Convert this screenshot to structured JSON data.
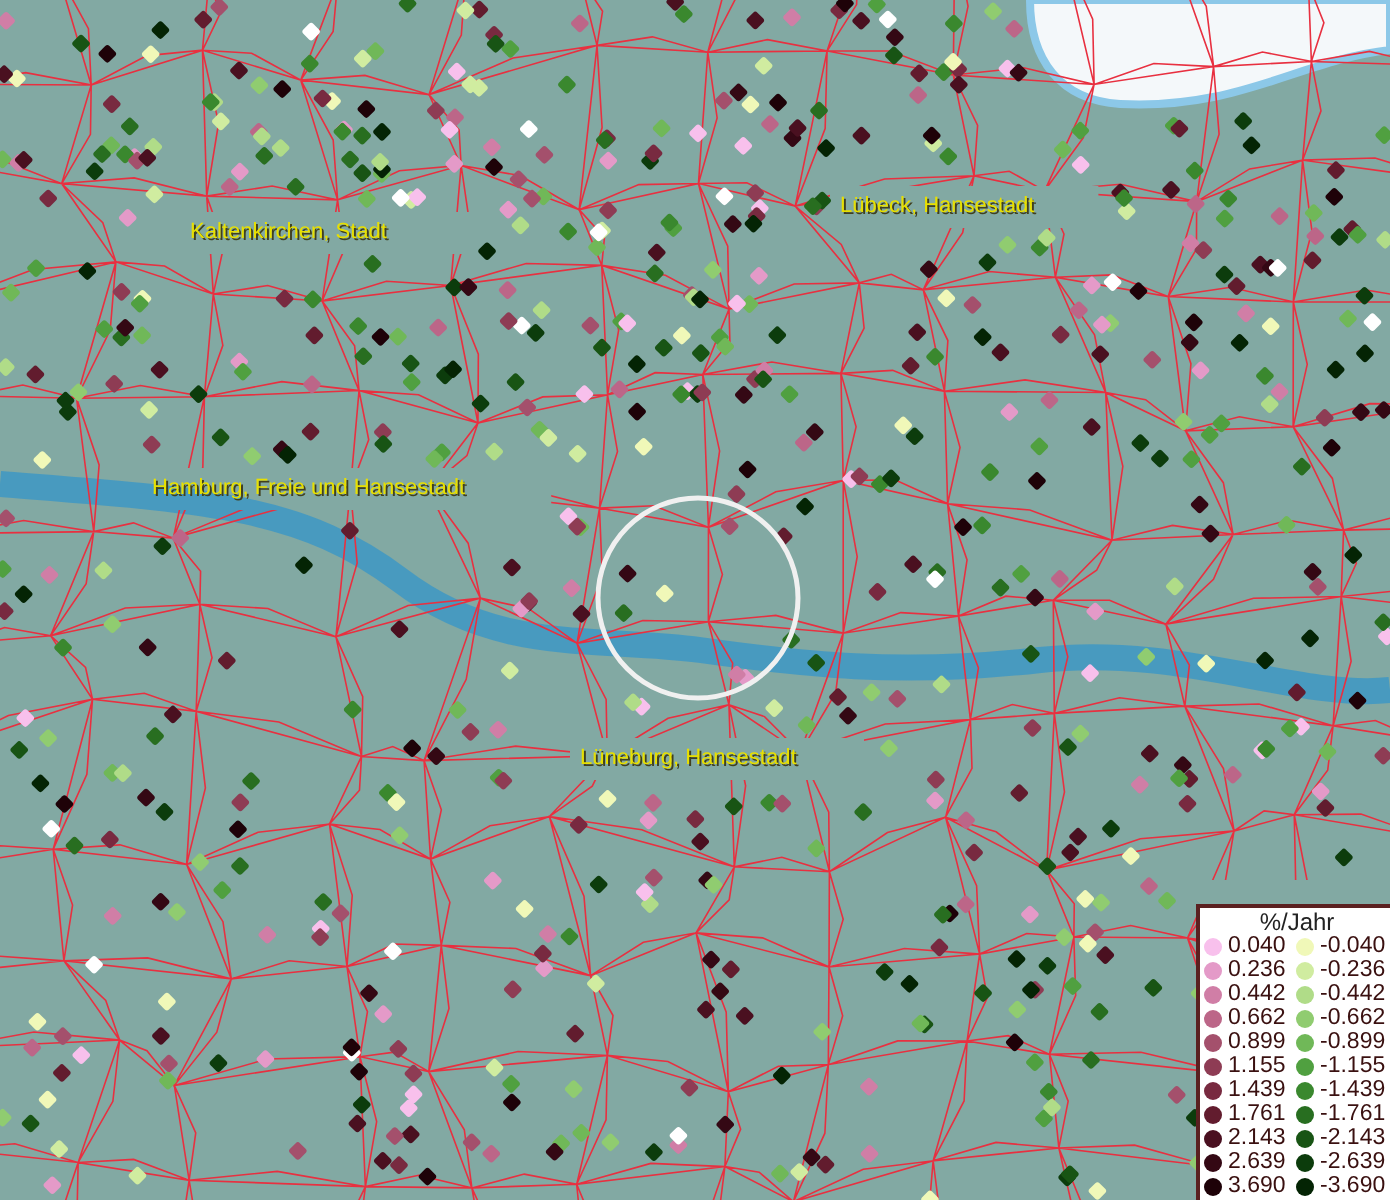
{
  "map": {
    "places": [
      {
        "name": "Kaltenkirchen, Stadt"
      },
      {
        "name": "Lübeck, Hansestadt"
      },
      {
        "name": "Hamburg, Freie und Hansestadt"
      },
      {
        "name": "Lüneburg, Hansestadt"
      }
    ]
  },
  "legend": {
    "title": "%/Jahr",
    "rows": [
      {
        "positive": {
          "value": "0.040",
          "color": "#f8c0ec"
        },
        "negative": {
          "value": "-0.040",
          "color": "#f0f8b8"
        }
      },
      {
        "positive": {
          "value": "0.236",
          "color": "#e49ac8"
        },
        "negative": {
          "value": "-0.236",
          "color": "#d0eca0"
        }
      },
      {
        "positive": {
          "value": "0.442",
          "color": "#d07ea6"
        },
        "negative": {
          "value": "-0.442",
          "color": "#b0dc88"
        }
      },
      {
        "positive": {
          "value": "0.662",
          "color": "#bc6688"
        },
        "negative": {
          "value": "-0.662",
          "color": "#90cc70"
        }
      },
      {
        "positive": {
          "value": "0.899",
          "color": "#a4506c"
        },
        "negative": {
          "value": "-0.899",
          "color": "#70b858"
        }
      },
      {
        "positive": {
          "value": "1.155",
          "color": "#8e3c54"
        },
        "negative": {
          "value": "-1.155",
          "color": "#50a040"
        }
      },
      {
        "positive": {
          "value": "1.439",
          "color": "#782a40"
        },
        "negative": {
          "value": "-1.439",
          "color": "#3a882e"
        }
      },
      {
        "positive": {
          "value": "1.761",
          "color": "#621c2e"
        },
        "negative": {
          "value": "-1.761",
          "color": "#286e20"
        }
      },
      {
        "positive": {
          "value": "2.143",
          "color": "#4a1020"
        },
        "negative": {
          "value": "-2.143",
          "color": "#185414"
        }
      },
      {
        "positive": {
          "value": "2.639",
          "color": "#340814"
        },
        "negative": {
          "value": "-2.639",
          "color": "#0c3c0c"
        }
      },
      {
        "positive": {
          "value": "3.690",
          "color": "#1e0208"
        },
        "negative": {
          "value": "-3.690",
          "color": "#042404"
        }
      }
    ]
  }
}
